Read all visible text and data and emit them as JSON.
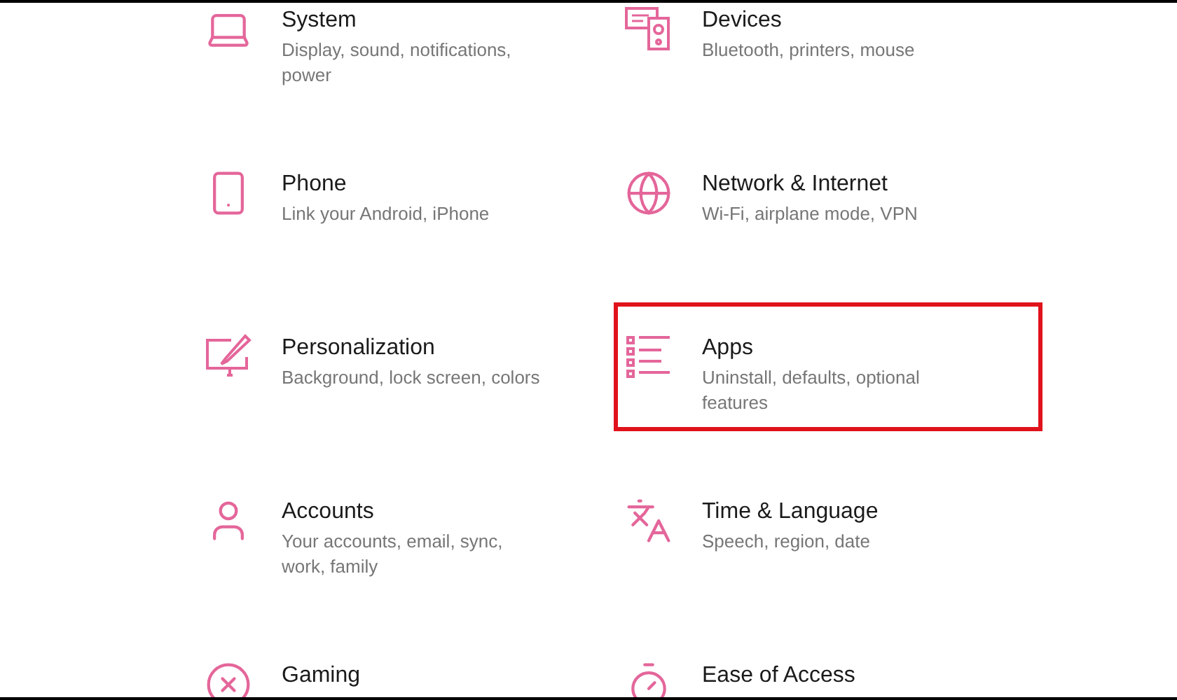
{
  "settings": [
    {
      "kind": "laptop",
      "title": "System",
      "description": "Display, sound, notifications, power",
      "highlighted": false
    },
    {
      "kind": "devices",
      "title": "Devices",
      "description": "Bluetooth, printers, mouse",
      "highlighted": false
    },
    {
      "kind": "phone",
      "title": "Phone",
      "description": "Link your Android, iPhone",
      "highlighted": false
    },
    {
      "kind": "globe",
      "title": "Network & Internet",
      "description": "Wi-Fi, airplane mode, VPN",
      "highlighted": false
    },
    {
      "kind": "paint",
      "title": "Personalization",
      "description": "Background, lock screen, colors",
      "highlighted": false
    },
    {
      "kind": "list",
      "title": "Apps",
      "description": "Uninstall, defaults, optional features",
      "highlighted": true
    },
    {
      "kind": "person",
      "title": "Accounts",
      "description": "Your accounts, email, sync, work, family",
      "highlighted": false
    },
    {
      "kind": "language",
      "title": "Time & Language",
      "description": "Speech, region, date",
      "highlighted": false
    },
    {
      "kind": "xbox",
      "title": "Gaming",
      "highlighted": false
    },
    {
      "kind": "access",
      "title": "Ease of Access",
      "highlighted": false
    }
  ]
}
